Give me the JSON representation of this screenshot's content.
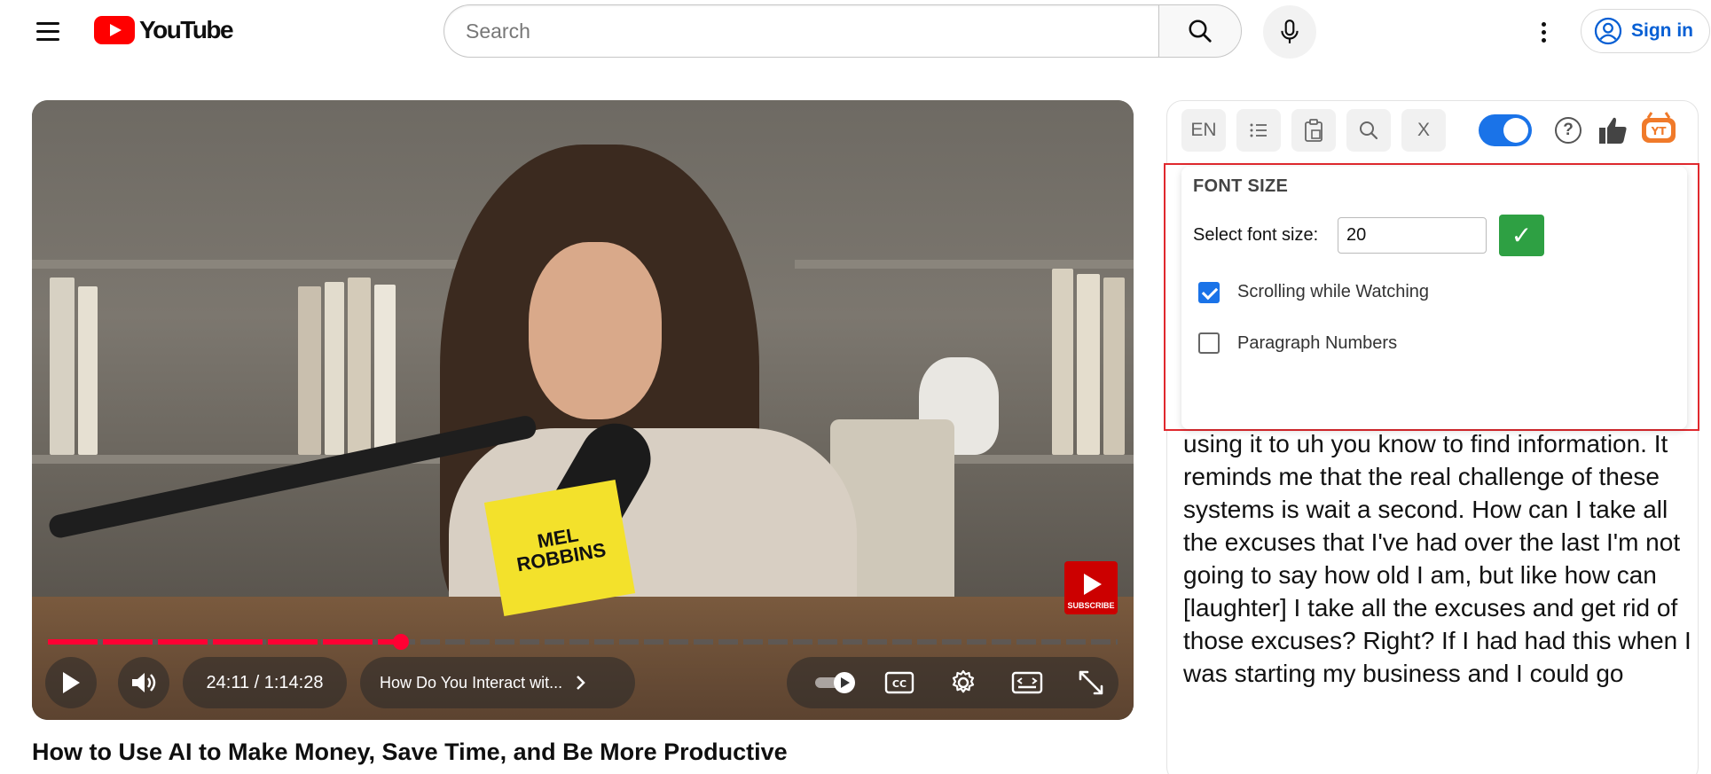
{
  "masthead": {
    "logo_text": "YouTube",
    "search_placeholder": "Search",
    "signin_label": "Sign in",
    "icons": [
      "menu-icon",
      "search-icon",
      "microphone-icon",
      "more-vert-icon",
      "account-circle-icon"
    ]
  },
  "player": {
    "time_display": "24:11 / 1:14:28",
    "chapter_label": "How Do You Interact wit...",
    "progress_fraction": 0.33,
    "mic_flag_text": "MEL ROBBINS",
    "subscribe_label": "SUBSCRIBE",
    "icons": [
      "play-icon",
      "volume-icon",
      "chevron-right-icon",
      "autoplay-toggle-icon",
      "captions-icon",
      "settings-gear-icon",
      "theater-mode-icon",
      "fullscreen-icon"
    ]
  },
  "video": {
    "title": "How to Use AI to Make Money, Save Time, and Be More Productive"
  },
  "extension": {
    "toolbar": {
      "lang_label": "EN",
      "close_label": "X",
      "toggle_on": true,
      "icons": [
        "list-icon",
        "clipboard-icon",
        "search-icon",
        "help-icon",
        "thumbs-up-icon",
        "extension-logo-icon"
      ]
    },
    "font_popup": {
      "heading": "FONT SIZE",
      "select_label": "Select font size:",
      "font_size_value": "20",
      "confirm_symbol": "✓",
      "options": [
        {
          "label": "Scrolling while Watching",
          "checked": true
        },
        {
          "label": "Paragraph Numbers",
          "checked": false
        }
      ]
    },
    "transcript_text": "using it to uh you know to find information. It reminds me that the real challenge of these systems is wait a second. How can I take all the excuses that I've had over the last I'm not going to say how old I am, but like how can [laughter] I take all the excuses and get rid of those excuses? Right? If I had had this when I was starting my business and I could go"
  },
  "colors": {
    "accent_blue": "#1a73e8",
    "youtube_red": "#ff0000",
    "progress_red": "#ff0033",
    "confirm_green": "#2ea043",
    "highlight_border": "#e0292e",
    "link_blue": "#065fd4"
  }
}
